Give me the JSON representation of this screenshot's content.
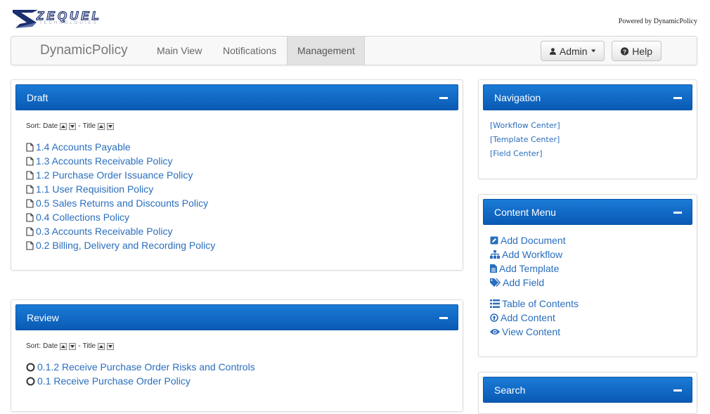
{
  "header": {
    "logo_text": "ZEQUEL",
    "logo_subtitle": "TECHNOLOGIES",
    "powered_by": "Powered by DynamicPolicy"
  },
  "navbar": {
    "brand": "DynamicPolicy",
    "links": [
      {
        "label": "Main View"
      },
      {
        "label": "Notifications"
      },
      {
        "label": "Management"
      }
    ],
    "admin_label": "Admin",
    "help_label": "Help"
  },
  "draft": {
    "title": "Draft",
    "sort": {
      "label": "Sort:",
      "date": "Date",
      "sep": "-",
      "title": "Title"
    },
    "items": [
      "1.4 Accounts Payable",
      "1.3 Accounts Receivable Policy",
      "1.2 Purchase Order Issuance Policy",
      "1.1 User Requisition Policy",
      "0.5 Sales Returns and Discounts Policy",
      "0.4 Collections Policy",
      "0.3 Accounts Receivable Policy",
      "0.2 Billing, Delivery and Recording Policy"
    ]
  },
  "review": {
    "title": "Review",
    "sort": {
      "label": "Sort:",
      "date": "Date",
      "sep": "-",
      "title": "Title"
    },
    "items": [
      "0.1.2 Receive Purchase Order Risks and Controls",
      "0.1 Receive Purchase Order Policy"
    ]
  },
  "navigation": {
    "title": "Navigation",
    "links": [
      "[Workflow Center]",
      "[Template Center]",
      "[Field Center]"
    ]
  },
  "content_menu": {
    "title": "Content Menu",
    "items": [
      {
        "label": "Add Document",
        "icon": "edit-icon"
      },
      {
        "label": "Add Workflow",
        "icon": "sitemap-icon"
      },
      {
        "label": "Add Template",
        "icon": "file-text-icon"
      },
      {
        "label": "Add Field",
        "icon": "tags-icon"
      },
      {
        "label": "Table of Contents",
        "icon": "list-icon"
      },
      {
        "label": "Add Content",
        "icon": "arrow-circle-up-icon"
      },
      {
        "label": "View Content",
        "icon": "eye-icon"
      }
    ]
  },
  "search": {
    "title": "Search"
  },
  "colors": {
    "header_blue": "#0a5ab4",
    "link_blue": "#2a6ebd"
  }
}
